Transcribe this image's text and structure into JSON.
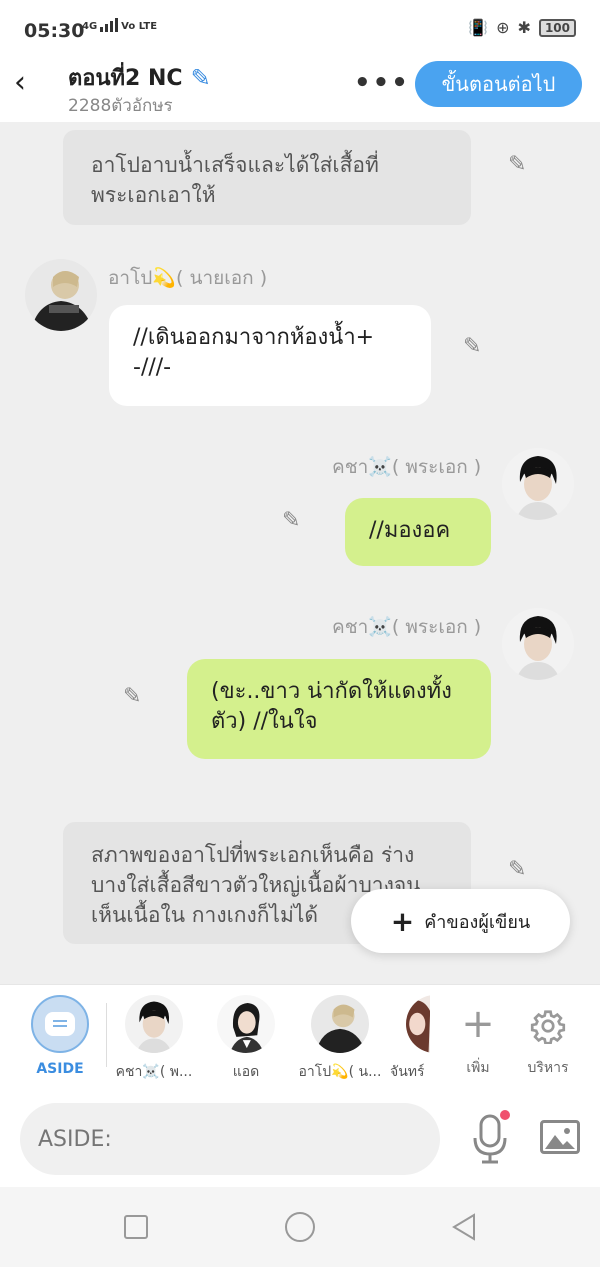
{
  "status": {
    "time": "05:30",
    "network": "4G",
    "volte": "Vo LTE",
    "battery": "100"
  },
  "header": {
    "title": "ตอนที่2 NC",
    "subtitle": "2288ตัวอักษร",
    "next_label": "ขั้นตอนต่อไป"
  },
  "messages": {
    "narr1": "อาโปอาบน้ำเสร็จและได้ใส่เสื้อที่พระเอกเอาให้",
    "m1_name": "อาโป💫( นายเอก )",
    "m1_text": "//เดินออกมาจากห้องน้ำ+ -///-",
    "m2_name": "คชา☠️( พระเอก )",
    "m2_text": "//มองอค",
    "m3_name": "คชา☠️( พระเอก )",
    "m3_text": "(ขะ..ขาว น่ากัดให้แดงทั้งตัว) //ในใจ",
    "narr2": "สภาพของอาโปที่พระเอกเห็นคือ ร่างบางใส่เสื้อสีขาวตัวใหญ่เนื้อผ้าบางจนเห็นเนื้อใน กางเกงก็ไม่ได้"
  },
  "fab": {
    "label": "คำของผู้เขียน"
  },
  "charbar": {
    "aside_label": "ASIDE",
    "chars": [
      "คชา☠️( พ...",
      "แอด",
      "อาโป💫( น...",
      "จันทร์"
    ],
    "add_label": "เพิ่ม",
    "manage_label": "บริหาร"
  },
  "input": {
    "placeholder": "ASIDE:"
  },
  "colors": {
    "accent": "#4aa3f0",
    "green_bubble": "#d4f08d",
    "narration": "#e4e4e4"
  }
}
